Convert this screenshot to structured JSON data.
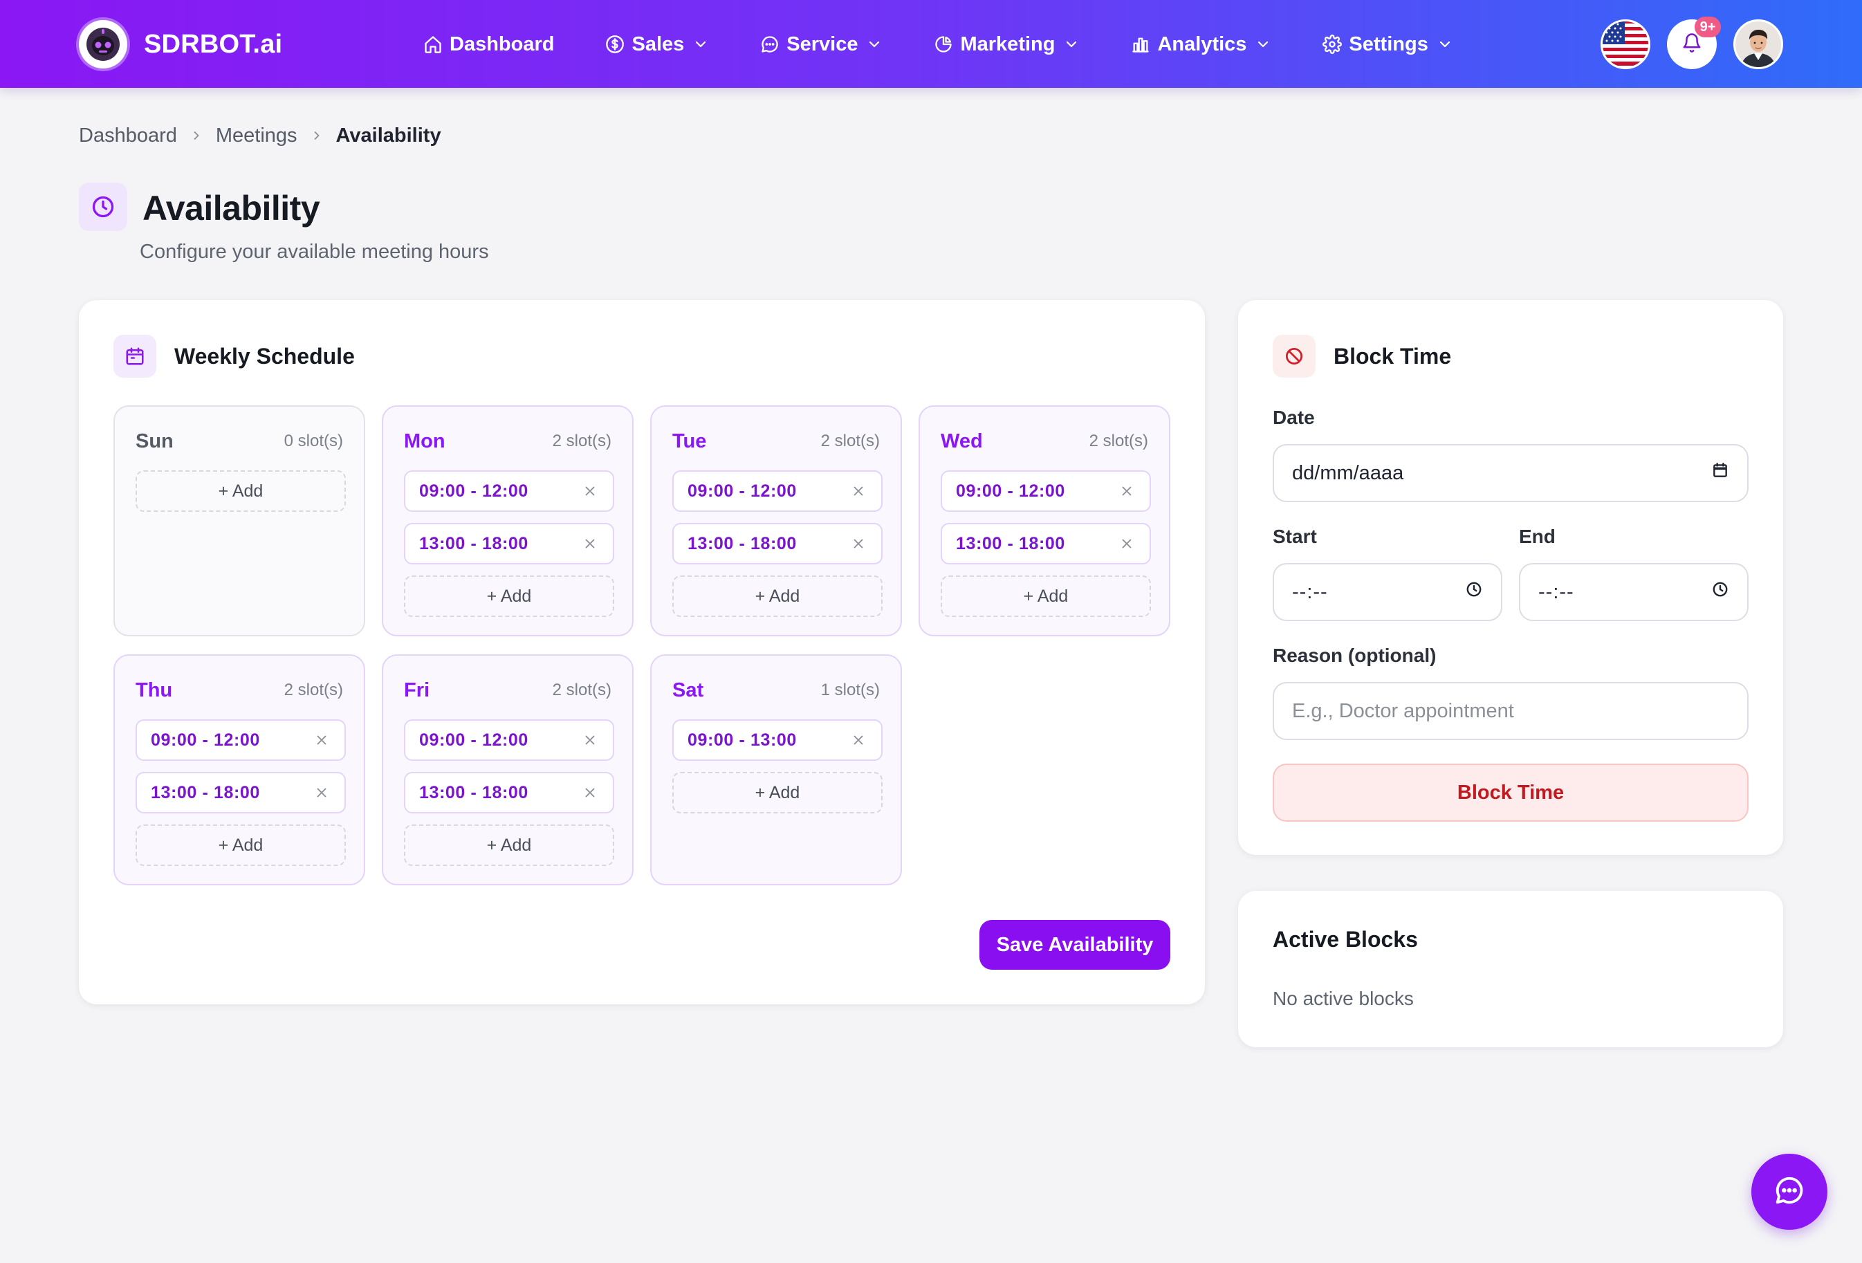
{
  "brand": {
    "name": "SDRBOT.ai",
    "logo_icon": "robot-icon"
  },
  "nav": {
    "items": [
      {
        "label": "Dashboard",
        "icon": "home-icon",
        "has_dropdown": false
      },
      {
        "label": "Sales",
        "icon": "dollar-circle-icon",
        "has_dropdown": true
      },
      {
        "label": "Service",
        "icon": "chat-bubble-icon",
        "has_dropdown": true
      },
      {
        "label": "Marketing",
        "icon": "pie-chart-icon",
        "has_dropdown": true
      },
      {
        "label": "Analytics",
        "icon": "bar-chart-icon",
        "has_dropdown": true
      },
      {
        "label": "Settings",
        "icon": "gear-icon",
        "has_dropdown": true
      }
    ],
    "language_flag": "us-flag-icon",
    "notifications_badge": "9+",
    "avatar": "user-avatar"
  },
  "breadcrumb": [
    "Dashboard",
    "Meetings",
    "Availability"
  ],
  "page": {
    "title": "Availability",
    "subtitle": "Configure your available meeting hours",
    "title_icon": "clock-icon"
  },
  "weekly_schedule": {
    "title": "Weekly Schedule",
    "icon": "calendar-icon",
    "add_label": "+ Add",
    "days": [
      {
        "name": "Sun",
        "count": "0 slot(s)",
        "slots": []
      },
      {
        "name": "Mon",
        "count": "2 slot(s)",
        "slots": [
          "09:00 - 12:00",
          "13:00 - 18:00"
        ]
      },
      {
        "name": "Tue",
        "count": "2 slot(s)",
        "slots": [
          "09:00 - 12:00",
          "13:00 - 18:00"
        ]
      },
      {
        "name": "Wed",
        "count": "2 slot(s)",
        "slots": [
          "09:00 - 12:00",
          "13:00 - 18:00"
        ]
      },
      {
        "name": "Thu",
        "count": "2 slot(s)",
        "slots": [
          "09:00 - 12:00",
          "13:00 - 18:00"
        ]
      },
      {
        "name": "Fri",
        "count": "2 slot(s)",
        "slots": [
          "09:00 - 12:00",
          "13:00 - 18:00"
        ]
      },
      {
        "name": "Sat",
        "count": "1 slot(s)",
        "slots": [
          "09:00 - 13:00"
        ]
      }
    ],
    "save_label": "Save Availability"
  },
  "block_time": {
    "title": "Block Time",
    "icon": "ban-icon",
    "date_label": "Date",
    "date_value": "dd/mm/aaaa",
    "start_label": "Start",
    "start_value": "--:--",
    "end_label": "End",
    "end_value": "--:--",
    "reason_label": "Reason (optional)",
    "reason_placeholder": "E.g., Doctor appointment",
    "button_label": "Block Time"
  },
  "active_blocks": {
    "title": "Active Blocks",
    "empty_text": "No active blocks"
  },
  "chat_fab_icon": "chat-icon",
  "colors": {
    "primary": "#8a0ff0",
    "nav_gradient_start": "#8a17f4",
    "nav_gradient_end": "#2f6cf9",
    "danger": "#c2181f",
    "page_bg": "#f4f4f6"
  }
}
